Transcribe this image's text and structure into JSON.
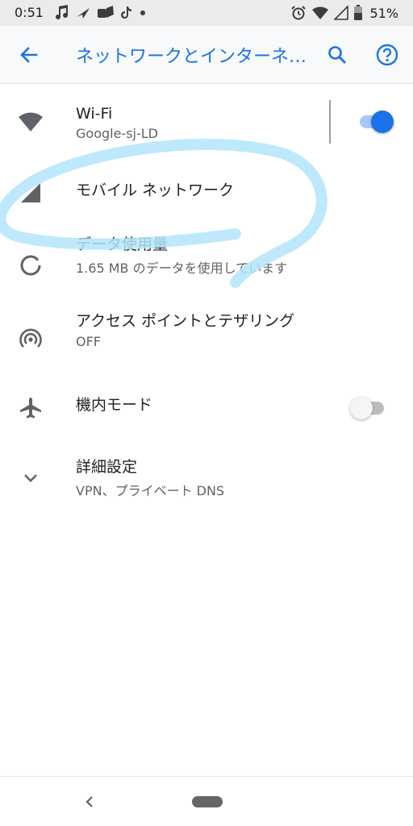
{
  "status_bar": {
    "time": "0:51",
    "battery_percent": "51%",
    "notification_icons": [
      "music-note-icon",
      "send-icon",
      "app-icon",
      "tiktok-icon",
      "dot-icon"
    ],
    "system_icons": [
      "alarm-icon",
      "wifi-icon",
      "signal-icon",
      "battery-icon"
    ]
  },
  "app_bar": {
    "title": "ネットワークとインターネット",
    "back_icon": "arrow-back-icon",
    "search_icon": "search-icon",
    "help_icon": "help-icon",
    "accent_color": "#1a73e8"
  },
  "settings": [
    {
      "id": "wifi",
      "icon": "wifi-icon",
      "title": "Wi-Fi",
      "subtitle": "Google-sj-LD",
      "toggle": true
    },
    {
      "id": "mobile",
      "icon": "signal-icon",
      "title": "モバイル ネットワーク"
    },
    {
      "id": "data",
      "icon": "data-usage-icon",
      "title": "データ使用量",
      "subtitle": "1.65 MB のデータを使用しています"
    },
    {
      "id": "hotspot",
      "icon": "hotspot-icon",
      "title": "アクセス ポイントとテザリング",
      "subtitle": "OFF"
    },
    {
      "id": "airplane",
      "icon": "airplane-icon",
      "title": "機内モード",
      "toggle": false
    },
    {
      "id": "advanced",
      "icon": "chevron-down-icon",
      "title": "詳細設定",
      "subtitle": "VPN、プライベート DNS"
    }
  ],
  "nav_bar": {
    "back_icon": "chevron-left-icon",
    "home_icon": "home-pill-icon"
  }
}
